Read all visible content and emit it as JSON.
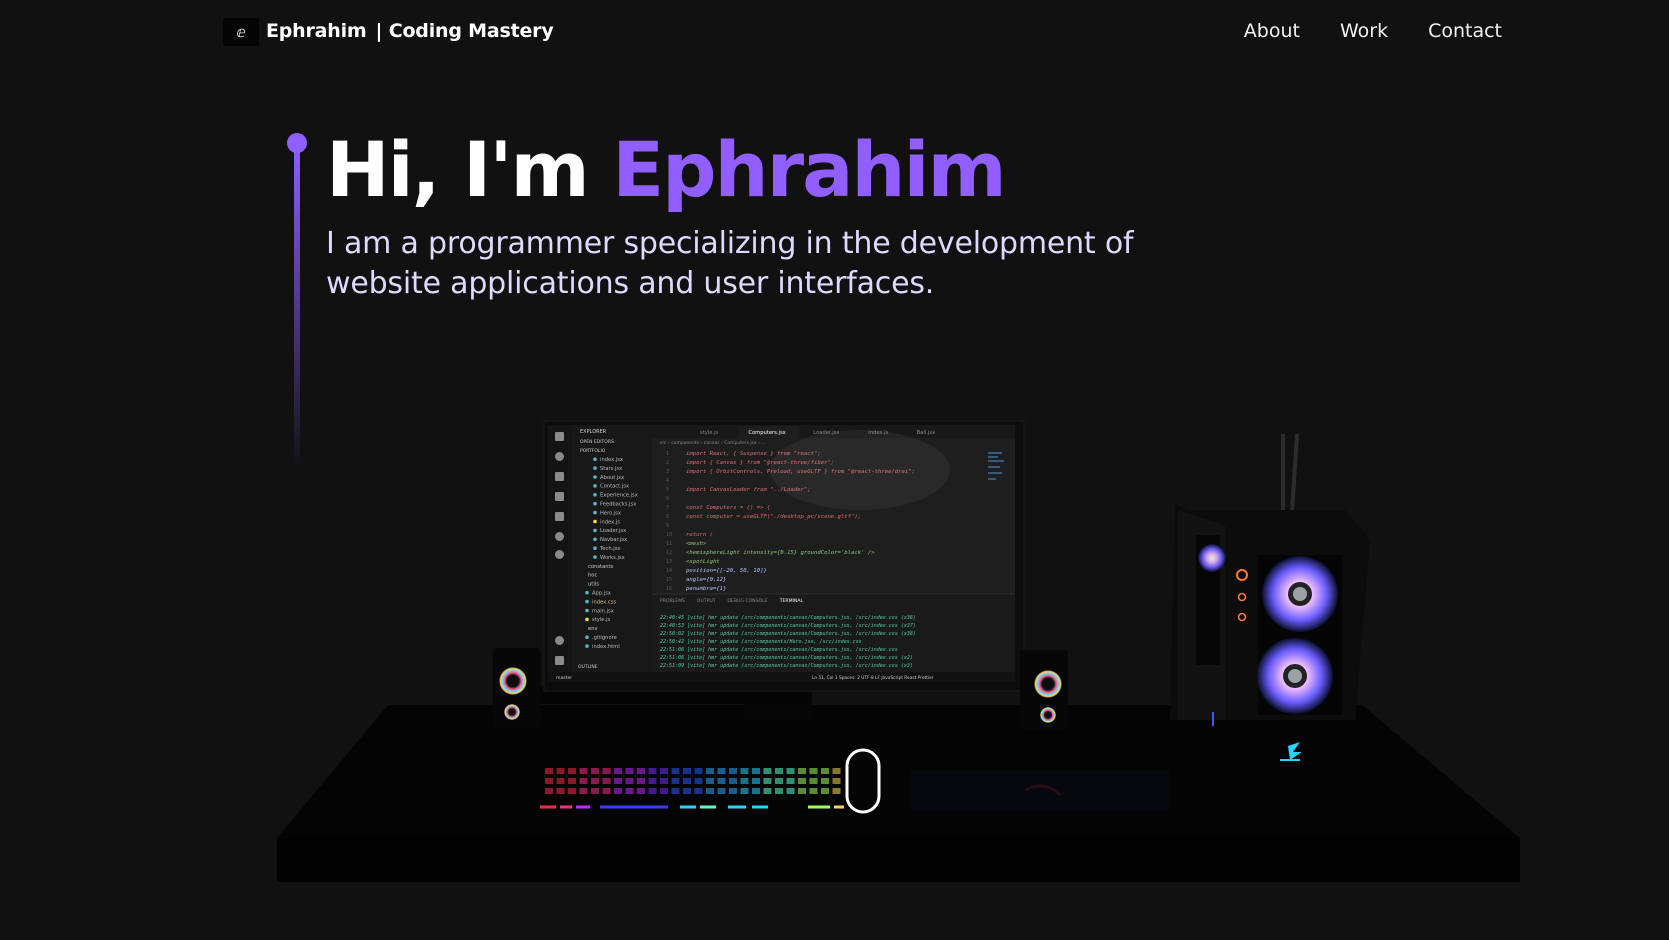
{
  "nav": {
    "logo_glyph": "ⅇ",
    "brand": "Ephrahim",
    "brand_suffix": "| Coding Mastery",
    "links": [
      "About",
      "Work",
      "Contact"
    ]
  },
  "hero": {
    "greeting": "Hi, I'm ",
    "name": "Ephrahim",
    "subtitle": "I am a programmer specializing in the development of website applications and user interfaces."
  },
  "colors": {
    "background": "#111112",
    "accent": "#915eff",
    "subtitle": "#dfd9ff"
  },
  "editor": {
    "tabs": [
      "style.js",
      "Computers.jsx",
      "Loader.jsx",
      "index.js",
      "Ball.jsx"
    ],
    "files": [
      "index.jsx",
      "Stars.jsx",
      "About.jsx",
      "Contact.jsx",
      "Experience.jsx",
      "Feedbacks.jsx",
      "Hero.jsx",
      "index.js",
      "Loader.jsx",
      "Navbar.jsx",
      "Tech.jsx",
      "Works.jsx",
      "constants",
      "hoc",
      "utils",
      "App.jsx",
      "index.css",
      "main.jsx",
      "style.js",
      "env",
      ".gitignore",
      "index.html"
    ],
    "code": [
      "import React, { Suspense } from \"react\";",
      "import { Canvas } from \"@react-three/fiber\";",
      "import { OrbitControls, Preload, useGLTF } from \"@react-three/drei\";",
      "",
      "import CanvasLoader from \"../Loader\";",
      "",
      "const Computers = () => {",
      "  const computer = useGLTF(\"./desktop_pc/scene.gltf\");",
      "",
      "  return (",
      "    <mesh>",
      "      <hemisphereLight intensity={0.15} groundColor='black' />",
      "      <spotLight",
      "        position={[-20, 50, 10]}",
      "        angle={0.12}",
      "        penumbra={1}"
    ],
    "panel_tabs": [
      "PROBLEMS",
      "OUTPUT",
      "DEBUG CONSOLE",
      "TERMINAL"
    ],
    "terminal": [
      "22:40:45 [vite] hmr update /src/components/canvas/Computers.jsx, /src/index.css (x36)",
      "22:40:53 [vite] hmr update /src/components/canvas/Computers.jsx, /src/index.css (x37)",
      "22:50:02 [vite] hmr update /src/components/canvas/Computers.jsx, /src/index.css (x38)",
      "22:50:42 [vite] hmr update /src/components/Hero.jsx, /src/index.css",
      "22:51:06 [vite] hmr update /src/components/canvas/Computers.jsx, /src/index.css",
      "22:51:06 [vite] hmr update /src/components/canvas/Computers.jsx, /src/index.css (x2)",
      "22:51:09 [vite] hmr update /src/components/canvas/Computers.jsx, /src/index.css (x3)"
    ],
    "status_left": "master",
    "status_right": "Ln 51, Col 1   Spaces: 2   UTF-8   LF   JavaScript React   Prettier"
  }
}
